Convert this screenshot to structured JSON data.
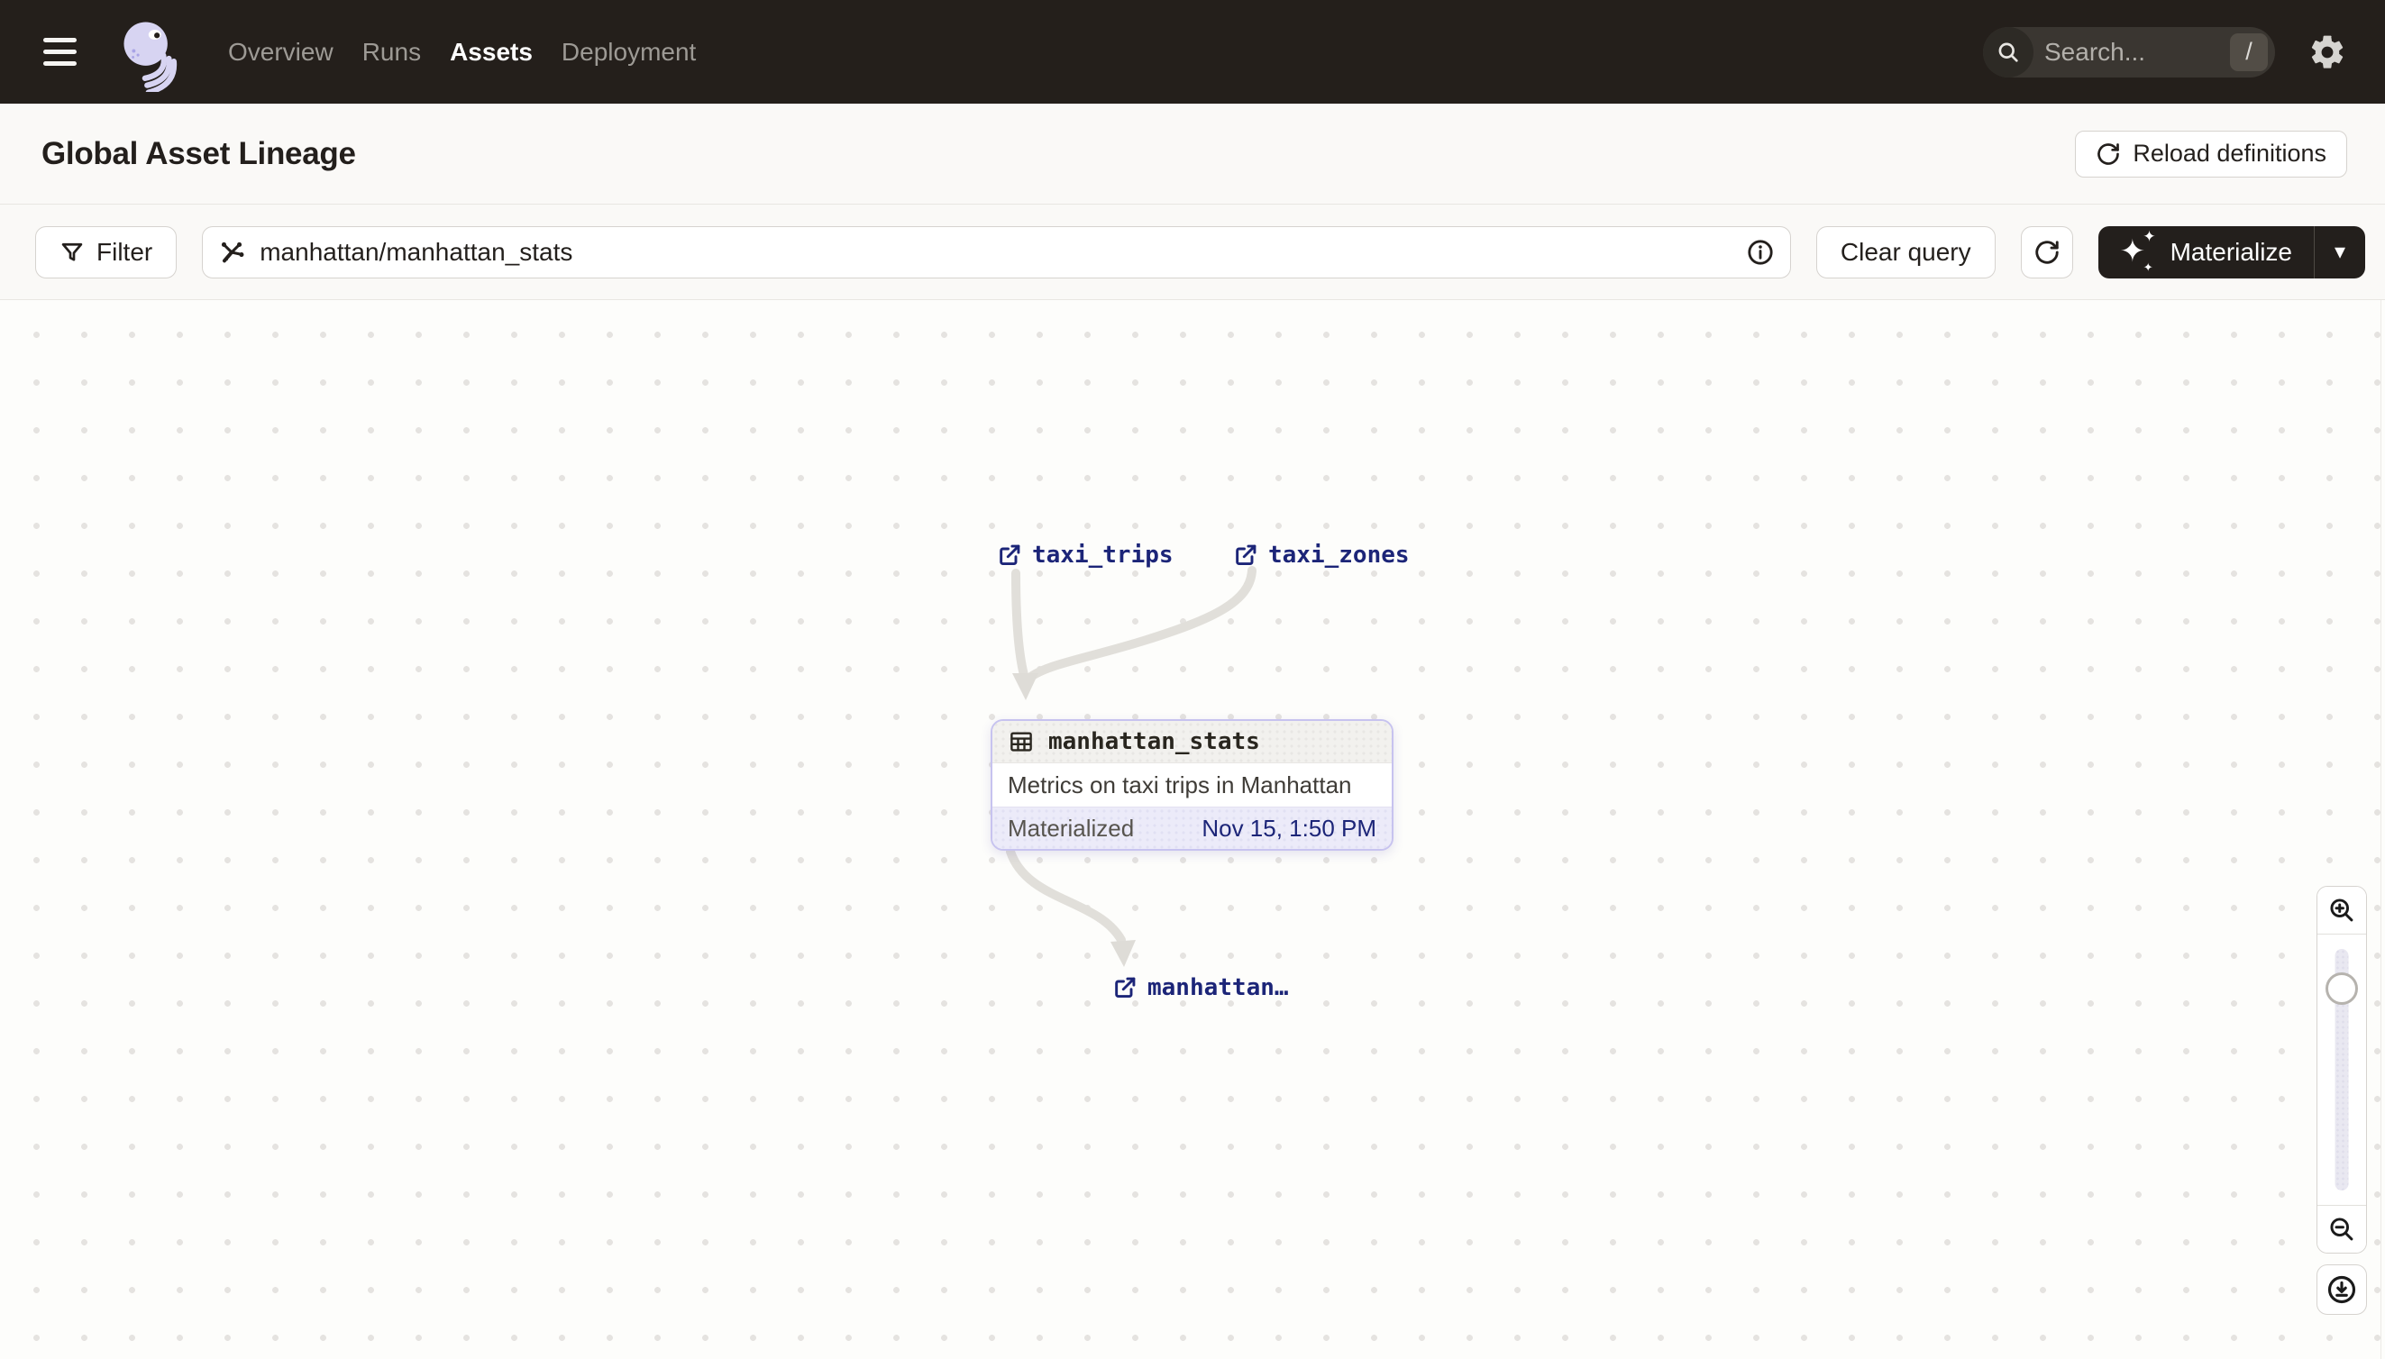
{
  "navbar": {
    "links": [
      {
        "label": "Overview",
        "active": false
      },
      {
        "label": "Runs",
        "active": false
      },
      {
        "label": "Assets",
        "active": true
      },
      {
        "label": "Deployment",
        "active": false
      }
    ],
    "search": {
      "placeholder": "Search...",
      "shortcut_key": "/"
    }
  },
  "header": {
    "title": "Global Asset Lineage",
    "reload_button_label": "Reload definitions"
  },
  "toolbar": {
    "filter_button_label": "Filter",
    "query_input_value": "manhattan/manhattan_stats",
    "clear_query_label": "Clear query",
    "materialize_label": "Materialize"
  },
  "graph": {
    "upstream_assets": [
      {
        "name": "taxi_trips"
      },
      {
        "name": "taxi_zones"
      }
    ],
    "selected_asset": {
      "name": "manhattan_stats",
      "description": "Metrics on taxi trips in Manhattan",
      "status_label": "Materialized",
      "materialized_time": "Nov 15, 1:50 PM"
    },
    "downstream_assets": [
      {
        "name": "manhattan…"
      }
    ]
  },
  "icons": {
    "sparkle_glyph": "✦",
    "caret_down_glyph": "▾"
  },
  "colors": {
    "navbar_bg": "#241f1b",
    "asset_link": "#1c2578",
    "card_border": "#c7c3ef",
    "card_footer_bg": "#ecebf9",
    "edge": "#e1dfda",
    "canvas_dot": "#e5e3e0",
    "materialize_bg": "#231f1c"
  }
}
